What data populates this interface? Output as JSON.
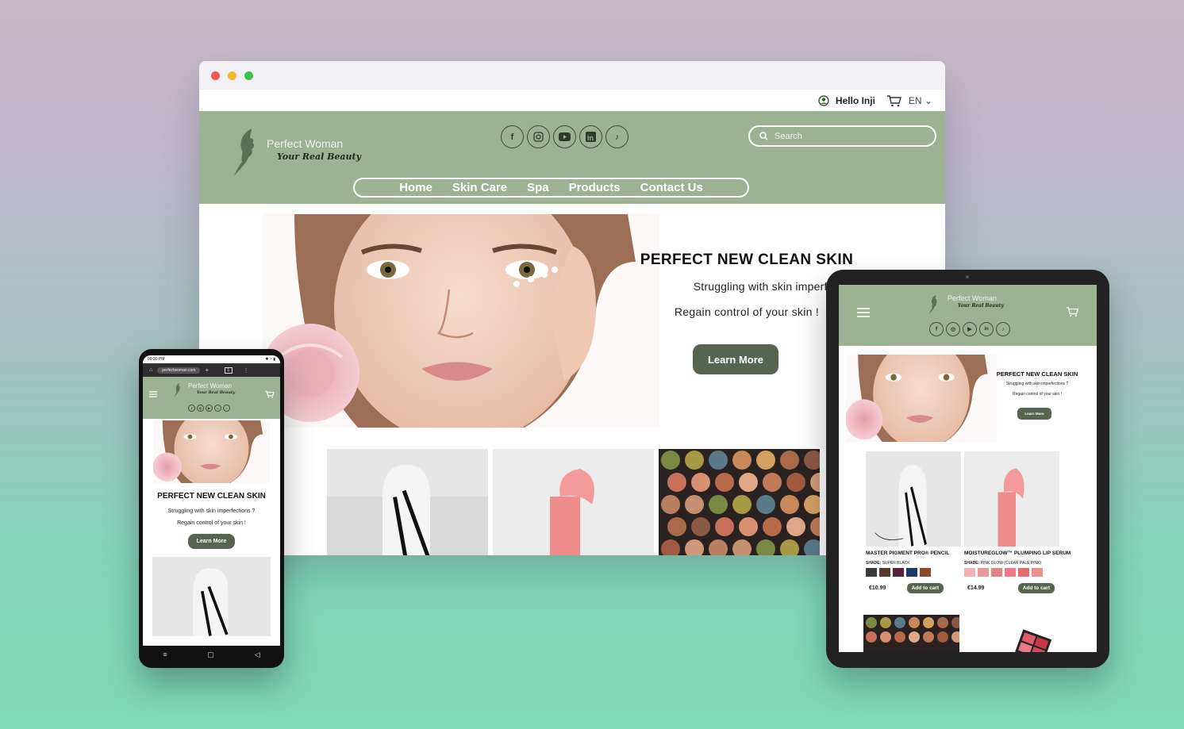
{
  "desktop": {
    "topbar": {
      "user_name": "Hello Inji",
      "lang": "EN"
    },
    "brand": {
      "name": "Perfect Woman",
      "tagline": "Your Real Beauty"
    },
    "social": [
      "facebook-icon",
      "instagram-icon",
      "youtube-icon",
      "linkedin-icon",
      "tiktok-icon"
    ],
    "search": {
      "placeholder": "Search"
    },
    "nav": [
      "Home",
      "Skin Care",
      "Spa",
      "Products",
      "Contact Us"
    ],
    "hero": {
      "title": "PERFECT NEW CLEAN SKIN",
      "line1": "Struggling with skin imperfections",
      "line2": "Regain control of your skin !",
      "button": "Learn More"
    }
  },
  "tablet": {
    "brand": {
      "name": "Perfect Woman",
      "tagline": "Your Real Beauty"
    },
    "hero": {
      "title": "PERFECT NEW CLEAN SKIN",
      "line1": "Struggling with skin imperfections ?",
      "line2": "Regain control of your skin !",
      "button": "Learn More"
    },
    "products": [
      {
        "name": "MASTER PIGMENT PRO® PENCIL",
        "shade_label": "SHADE:",
        "shade": "SUPER BLACK",
        "price": "€10.99",
        "button": "Add to cart",
        "swatches": [
          "#3a3a3a",
          "#5a3a2c",
          "#5a1f3a",
          "#1f3a6a",
          "#8a4a2c"
        ]
      },
      {
        "name": "MOISTUREGLOW™ PLUMPING LIP SERUM",
        "shade_label": "SHADE:",
        "shade": "PINK GLOW (CLEAR PALE PINK)",
        "price": "€14.99",
        "button": "Add to cart",
        "swatches": [
          "#f1b3b3",
          "#e89a9a",
          "#e58383",
          "#ef7a86",
          "#e66a6a",
          "#e8928a"
        ]
      }
    ]
  },
  "phone": {
    "status": {
      "time": "09:30 PM"
    },
    "url": "perfectwoman.com",
    "brand": {
      "name": "Perfect Woman",
      "tagline": "Your Real Beauty"
    },
    "hero": {
      "title": "PERFECT NEW CLEAN SKIN",
      "line1": "Struggling with skin imperfections ?",
      "line2": "Regain control of your skin !",
      "button": "Learn More"
    }
  },
  "colors": {
    "header_green": "#9db293",
    "button_green": "#56654f",
    "background_top": "#c9b9c4",
    "background_bottom": "#7dd9b6"
  }
}
